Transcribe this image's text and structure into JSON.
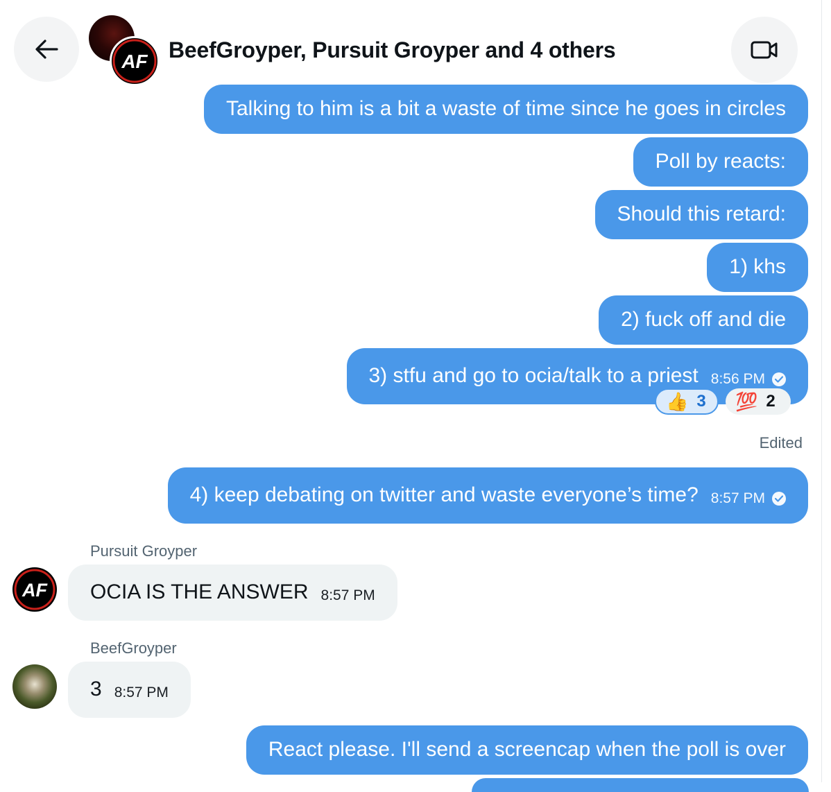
{
  "header": {
    "title": "BeefGroyper, Pursuit Groyper and 4 others",
    "back_icon": "arrow-left-icon",
    "video_icon": "video-camera-icon"
  },
  "messages_out": [
    {
      "text": "Talking to him is a bit a waste of time since he goes in circles"
    },
    {
      "text": "Poll by reacts:"
    },
    {
      "text": "Should this retard:"
    },
    {
      "text": "1) khs"
    },
    {
      "text": "2) fuck off and die"
    },
    {
      "text": "3) stfu and go to ocia/talk to a priest",
      "time": "8:56 PM"
    }
  ],
  "reactions": [
    {
      "emoji": "👍",
      "count": "3"
    },
    {
      "emoji": "💯",
      "count": "2"
    }
  ],
  "edited_label": "Edited",
  "message_4": {
    "text": "4) keep debating on twitter and waste everyone’s time?",
    "time": "8:57 PM"
  },
  "incoming": [
    {
      "sender": "Pursuit Groyper",
      "text": "OCIA IS THE ANSWER",
      "time": "8:57 PM"
    },
    {
      "sender": "BeefGroyper",
      "text": "3",
      "time": "8:57 PM"
    }
  ],
  "last_out": {
    "text": "React please. I'll send a screencap when the poll is over"
  },
  "colors": {
    "outgoing_bubble": "#4a98e9",
    "incoming_bubble": "#eff3f4",
    "secondary_text": "#536471"
  }
}
